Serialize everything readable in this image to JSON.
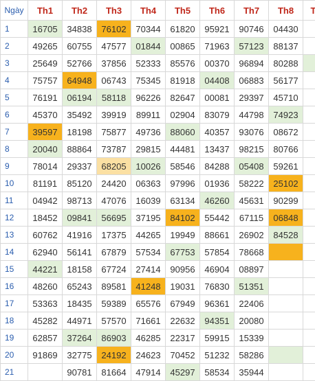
{
  "table": {
    "day_header": "Ngày",
    "columns": [
      "Th1",
      "Th2",
      "Th3",
      "Th4",
      "Th5",
      "Th6",
      "Th7",
      "Th8",
      "T"
    ],
    "colors": {
      "green_highlight": "#e2f0d9",
      "orange_highlight": "#f7b21d",
      "header_red": "#c0281b",
      "day_blue": "#2a5dae"
    },
    "rows": [
      {
        "day": "1",
        "cells": [
          {
            "v": "16705",
            "hl": "g",
            "tail": "05"
          },
          {
            "v": "34838"
          },
          {
            "v": "76102",
            "hl": "o"
          },
          {
            "v": "70344"
          },
          {
            "v": "61820"
          },
          {
            "v": "95921"
          },
          {
            "v": "90746"
          },
          {
            "v": "04430"
          },
          {
            "v": ""
          }
        ]
      },
      {
        "day": "2",
        "cells": [
          {
            "v": "49265"
          },
          {
            "v": "60755"
          },
          {
            "v": "47577"
          },
          {
            "v": "01844",
            "hl": "g"
          },
          {
            "v": "00865"
          },
          {
            "v": "71963"
          },
          {
            "v": "57123",
            "hl": "g"
          },
          {
            "v": "88137"
          },
          {
            "v": ""
          }
        ]
      },
      {
        "day": "3",
        "cells": [
          {
            "v": "25649"
          },
          {
            "v": "52766"
          },
          {
            "v": "37856"
          },
          {
            "v": "52333"
          },
          {
            "v": "85576"
          },
          {
            "v": "00370"
          },
          {
            "v": "96894"
          },
          {
            "v": "80288"
          },
          {
            "v": "",
            "hl": "g"
          }
        ]
      },
      {
        "day": "4",
        "cells": [
          {
            "v": "75757"
          },
          {
            "v": "64948",
            "hl": "o"
          },
          {
            "v": "06743"
          },
          {
            "v": "75345"
          },
          {
            "v": "81918"
          },
          {
            "v": "04408",
            "hl": "g"
          },
          {
            "v": "06883"
          },
          {
            "v": "56177"
          },
          {
            "v": ""
          }
        ]
      },
      {
        "day": "5",
        "cells": [
          {
            "v": "76191"
          },
          {
            "v": "06194",
            "hl": "g"
          },
          {
            "v": "58118",
            "hl": "g"
          },
          {
            "v": "96226"
          },
          {
            "v": "82647"
          },
          {
            "v": "00081"
          },
          {
            "v": "29397"
          },
          {
            "v": "45710"
          },
          {
            "v": ""
          }
        ]
      },
      {
        "day": "6",
        "cells": [
          {
            "v": "45370"
          },
          {
            "v": "35492"
          },
          {
            "v": "39919"
          },
          {
            "v": "89911"
          },
          {
            "v": "02904"
          },
          {
            "v": "83079"
          },
          {
            "v": "44798"
          },
          {
            "v": "74923",
            "hl": "g"
          },
          {
            "v": ""
          }
        ]
      },
      {
        "day": "7",
        "cells": [
          {
            "v": "39597",
            "hl": "o"
          },
          {
            "v": "18198"
          },
          {
            "v": "75877"
          },
          {
            "v": "49736"
          },
          {
            "v": "88060",
            "hl": "g"
          },
          {
            "v": "40357"
          },
          {
            "v": "93076"
          },
          {
            "v": "08672"
          },
          {
            "v": ""
          }
        ]
      },
      {
        "day": "8",
        "cells": [
          {
            "v": "20040",
            "hl": "g"
          },
          {
            "v": "88864"
          },
          {
            "v": "73787"
          },
          {
            "v": "29815"
          },
          {
            "v": "44481"
          },
          {
            "v": "13437"
          },
          {
            "v": "98215"
          },
          {
            "v": "80766"
          },
          {
            "v": ""
          }
        ]
      },
      {
        "day": "9",
        "cells": [
          {
            "v": "78014"
          },
          {
            "v": "29337"
          },
          {
            "v": "68205",
            "hl": "y"
          },
          {
            "v": "10026",
            "hl": "g"
          },
          {
            "v": "58546"
          },
          {
            "v": "84288"
          },
          {
            "v": "05408",
            "hl": "g"
          },
          {
            "v": "59261"
          },
          {
            "v": ""
          }
        ]
      },
      {
        "day": "10",
        "cells": [
          {
            "v": "81191"
          },
          {
            "v": "85120"
          },
          {
            "v": "24420"
          },
          {
            "v": "06363"
          },
          {
            "v": "97996"
          },
          {
            "v": "01936"
          },
          {
            "v": "58222"
          },
          {
            "v": "25102",
            "hl": "o"
          },
          {
            "v": ""
          }
        ]
      },
      {
        "day": "11",
        "cells": [
          {
            "v": "04942"
          },
          {
            "v": "98713"
          },
          {
            "v": "47076"
          },
          {
            "v": "16039"
          },
          {
            "v": "63134"
          },
          {
            "v": "46260",
            "hl": "g"
          },
          {
            "v": "45631"
          },
          {
            "v": "90299"
          },
          {
            "v": ""
          }
        ]
      },
      {
        "day": "12",
        "cells": [
          {
            "v": "18452"
          },
          {
            "v": "09841",
            "hl": "g"
          },
          {
            "v": "56695",
            "hl": "g"
          },
          {
            "v": "37195"
          },
          {
            "v": "84102",
            "hl": "o"
          },
          {
            "v": "55442"
          },
          {
            "v": "67115"
          },
          {
            "v": "06848",
            "hl": "o"
          },
          {
            "v": ""
          }
        ]
      },
      {
        "day": "13",
        "cells": [
          {
            "v": "60762"
          },
          {
            "v": "41916"
          },
          {
            "v": "17375"
          },
          {
            "v": "44265"
          },
          {
            "v": "19949"
          },
          {
            "v": "88661"
          },
          {
            "v": "26902"
          },
          {
            "v": "84528",
            "hl": "g"
          },
          {
            "v": ""
          }
        ]
      },
      {
        "day": "14",
        "cells": [
          {
            "v": "62940"
          },
          {
            "v": "56141"
          },
          {
            "v": "67879"
          },
          {
            "v": "57534"
          },
          {
            "v": "67753",
            "hl": "g"
          },
          {
            "v": "57854"
          },
          {
            "v": "78668"
          },
          {
            "v": "",
            "hl": "o"
          },
          {
            "v": ""
          }
        ]
      },
      {
        "day": "15",
        "cells": [
          {
            "v": "44221",
            "hl": "g"
          },
          {
            "v": "18158"
          },
          {
            "v": "67724"
          },
          {
            "v": "27414"
          },
          {
            "v": "90956"
          },
          {
            "v": "46904"
          },
          {
            "v": "08897"
          },
          {
            "v": ""
          },
          {
            "v": ""
          }
        ]
      },
      {
        "day": "16",
        "cells": [
          {
            "v": "48260"
          },
          {
            "v": "65243"
          },
          {
            "v": "89581"
          },
          {
            "v": "41248",
            "hl": "o"
          },
          {
            "v": "19031"
          },
          {
            "v": "76830"
          },
          {
            "v": "51351",
            "hl": "g"
          },
          {
            "v": ""
          },
          {
            "v": ""
          }
        ]
      },
      {
        "day": "17",
        "cells": [
          {
            "v": "53363"
          },
          {
            "v": "18435"
          },
          {
            "v": "59389"
          },
          {
            "v": "65576"
          },
          {
            "v": "67949"
          },
          {
            "v": "96361"
          },
          {
            "v": "22406"
          },
          {
            "v": ""
          },
          {
            "v": ""
          }
        ]
      },
      {
        "day": "18",
        "cells": [
          {
            "v": "45282"
          },
          {
            "v": "44971"
          },
          {
            "v": "57570"
          },
          {
            "v": "71661"
          },
          {
            "v": "22632"
          },
          {
            "v": "94351",
            "hl": "g"
          },
          {
            "v": "20080"
          },
          {
            "v": ""
          },
          {
            "v": ""
          }
        ]
      },
      {
        "day": "19",
        "cells": [
          {
            "v": "62857"
          },
          {
            "v": "37264",
            "hl": "g"
          },
          {
            "v": "86903",
            "hl": "g"
          },
          {
            "v": "46285"
          },
          {
            "v": "22317"
          },
          {
            "v": "59915"
          },
          {
            "v": "15339"
          },
          {
            "v": ""
          },
          {
            "v": ""
          }
        ]
      },
      {
        "day": "20",
        "cells": [
          {
            "v": "91869"
          },
          {
            "v": "32775"
          },
          {
            "v": "24192",
            "hl": "o"
          },
          {
            "v": "24623"
          },
          {
            "v": "70452"
          },
          {
            "v": "51232"
          },
          {
            "v": "58286"
          },
          {
            "v": "",
            "hl": "g"
          },
          {
            "v": ""
          }
        ]
      },
      {
        "day": "21",
        "cells": [
          {
            "v": ""
          },
          {
            "v": "90781"
          },
          {
            "v": "81664"
          },
          {
            "v": "47914"
          },
          {
            "v": "45297",
            "hl": "g"
          },
          {
            "v": "58534"
          },
          {
            "v": "35944"
          },
          {
            "v": ""
          },
          {
            "v": ""
          }
        ]
      }
    ]
  }
}
